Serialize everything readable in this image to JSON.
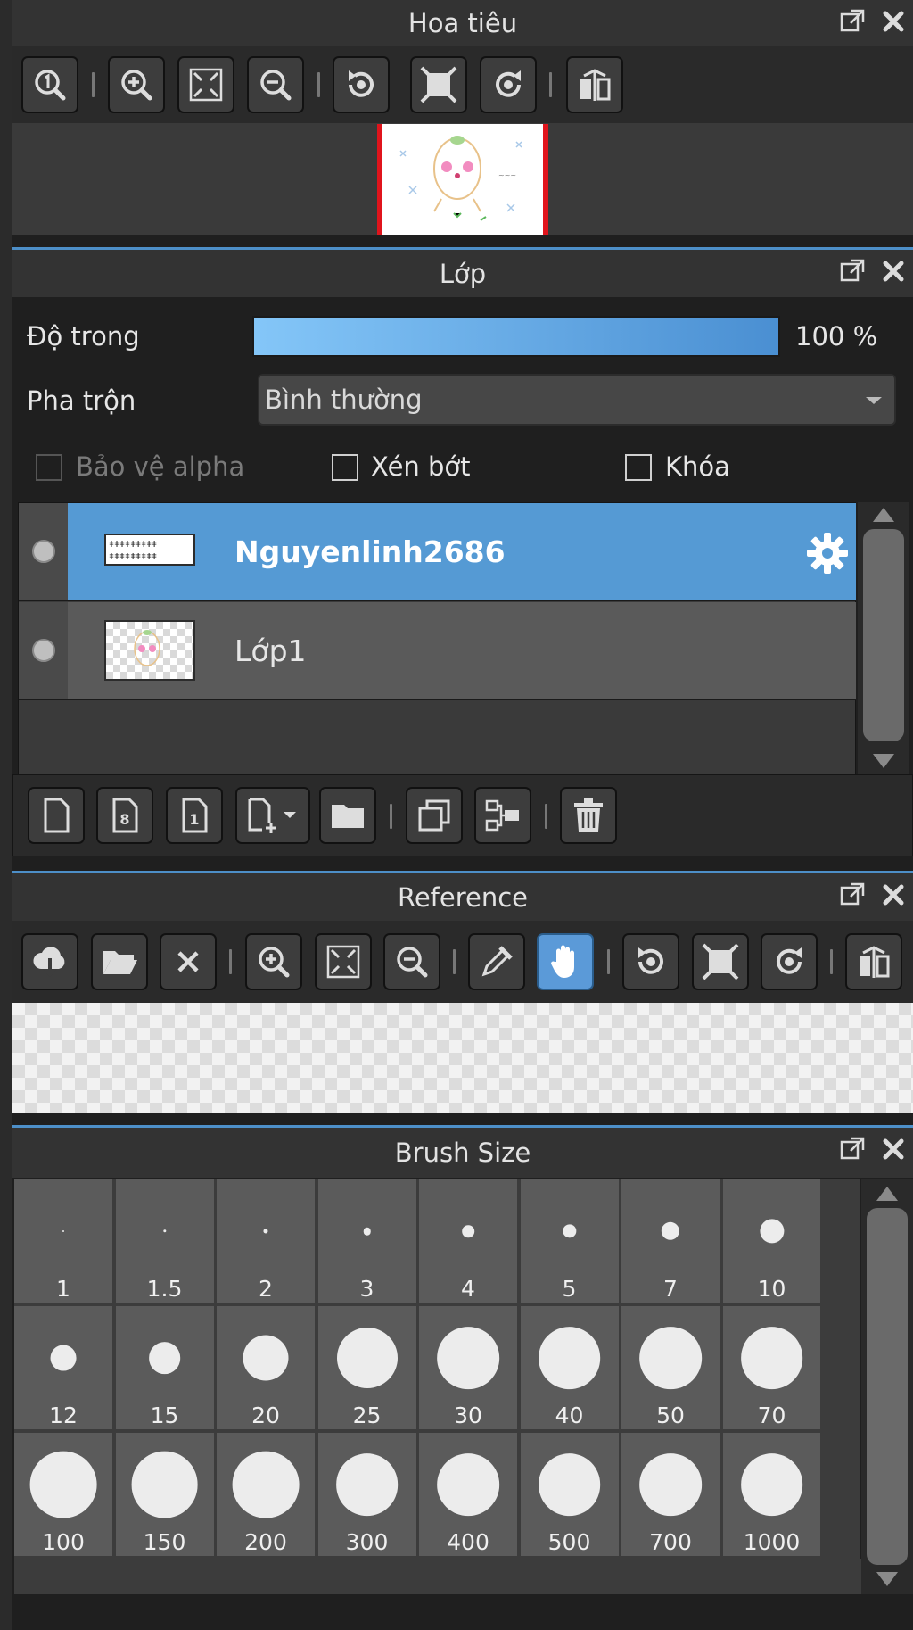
{
  "navigator": {
    "title": "Hoa tiêu",
    "tools": [
      "actual-size-icon",
      "zoom-in-icon",
      "fit-screen-icon",
      "zoom-out-icon",
      "rotate-left-icon",
      "reset-view-icon",
      "rotate-right-icon",
      "flip-icon"
    ]
  },
  "layer_panel": {
    "title": "Lớp",
    "opacity_label": "Độ trong",
    "opacity_value": "100 %",
    "opacity_fraction": 1.0,
    "blend_label": "Pha trộn",
    "blend_value": "Bình thường",
    "protect_alpha_label": "Bảo vệ alpha",
    "clipping_label": "Xén bớt",
    "lock_label": "Khóa",
    "layers": [
      {
        "name": "Nguyenlinh2686",
        "selected": true
      },
      {
        "name": "Lớp1",
        "selected": false
      }
    ],
    "tools": [
      "new-layer-icon",
      "new-8bit-layer-icon",
      "new-1bit-layer-icon",
      "add-layer-dropdown-icon",
      "folder-icon",
      "duplicate-layer-icon",
      "merge-down-icon",
      "delete-layer-icon"
    ]
  },
  "reference": {
    "title": "Reference",
    "active_tool": "hand-tool-icon"
  },
  "brush_size": {
    "title": "Brush Size",
    "sizes": [
      "1",
      "1.5",
      "2",
      "3",
      "4",
      "5",
      "7",
      "10",
      "12",
      "15",
      "20",
      "25",
      "30",
      "40",
      "50",
      "70",
      "100",
      "150",
      "200",
      "300",
      "400",
      "500",
      "700",
      "1000"
    ]
  },
  "colors": {
    "accent": "#5b9ad8",
    "selection_border": "#e0141c"
  }
}
